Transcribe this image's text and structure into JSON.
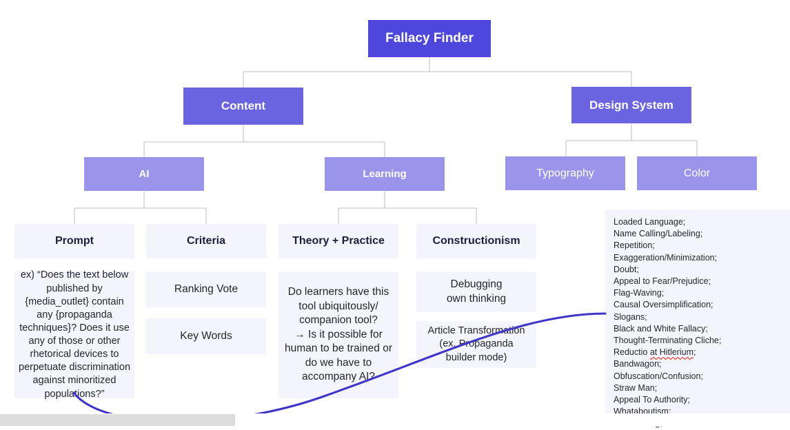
{
  "diagram": {
    "type": "tree-hierarchy",
    "root": {
      "label": "Fallacy Finder"
    },
    "level1": [
      {
        "label": "Content"
      },
      {
        "label": "Design System"
      }
    ],
    "level2": [
      {
        "label": "AI"
      },
      {
        "label": "Learning"
      },
      {
        "label": "Typography"
      },
      {
        "label": "Color"
      }
    ],
    "level3": [
      {
        "label": "Prompt"
      },
      {
        "label": "Criteria"
      },
      {
        "label": "Theory + Practice"
      },
      {
        "label": "Constructionism"
      }
    ],
    "leaves": {
      "prompt_example": "ex) “Does the text below published by {media_outlet} contain any {propaganda techniques}? Does it use any of those or other rhetorical devices to perpetuate discrimination against minoritized populations?”",
      "criteria_ranking_vote": "Ranking Vote",
      "criteria_key_words": "Key Words",
      "theory_practice_note": "Do learners have this tool ubiquitously/ companion tool?\n→ Is it possible for human to be trained or do we have to accompany AI?",
      "constructionism_debugging": "Debugging\nown thinking",
      "constructionism_article": "Article Transformation\n(ex. Propaganda\nbuilder mode)"
    }
  },
  "fallacy_list": {
    "items": [
      {
        "text": "Loaded Language;",
        "misspelled": false
      },
      {
        "text": "Name Calling/Labeling;",
        "misspelled": false
      },
      {
        "text": "Repetition;",
        "misspelled": false
      },
      {
        "text": "Exaggeration/Minimization;",
        "misspelled": false
      },
      {
        "text": "Doubt;",
        "misspelled": false
      },
      {
        "text": "Appeal to Fear/Prejudice;",
        "misspelled": false
      },
      {
        "text": "Flag-Waving;",
        "misspelled": false
      },
      {
        "text": "Causal Oversimplification;",
        "misspelled": false
      },
      {
        "text": "Slogans;",
        "misspelled": false
      },
      {
        "text": "Black and White Fallacy;",
        "misspelled": false
      },
      {
        "text": "Thought-Terminating Cliche;",
        "misspelled": false
      },
      {
        "text": "Reductio at Hitlerium;",
        "misspelled": true,
        "prefix": "Reductio ",
        "spellcheck_span": "at Hitlerium",
        "suffix": ";"
      },
      {
        "text": "Bandwagon;",
        "misspelled": false
      },
      {
        "text": "Obfuscation/Confusion;",
        "misspelled": false
      },
      {
        "text": "Straw Man;",
        "misspelled": false
      },
      {
        "text": "Appeal To Authority;",
        "misspelled": false
      },
      {
        "text": "Whataboutism;",
        "misspelled": false
      },
      {
        "text": "Red Herring;",
        "misspelled": false
      }
    ]
  },
  "colors": {
    "root_box": "#4f46dd",
    "level1_box": "#6a64e0",
    "level2_box": "#9a95ea",
    "leaf_box": "#f4f4fd",
    "connector_line": "#bcbcbc",
    "annotation_curve": "#3f35c8",
    "spellcheck_underline": "#e8483c",
    "scrollbar_thumb": "#dcdcdc"
  }
}
